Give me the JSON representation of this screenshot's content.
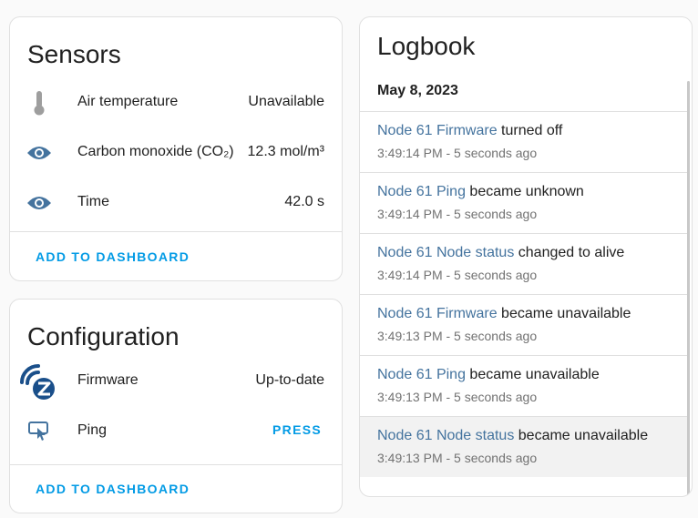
{
  "colors": {
    "background": "#fafafa",
    "accent": "#039be5",
    "entity_link": "#44739e",
    "icon": "#44739e"
  },
  "sensors": {
    "title": "Sensors",
    "rows": [
      {
        "icon": "thermometer-icon",
        "name": "Air temperature",
        "value": "Unavailable"
      },
      {
        "icon": "eye-icon",
        "name": "Carbon monoxide (CO₂)",
        "value": "12.3 mol/m³"
      },
      {
        "icon": "eye-icon",
        "name": "Time",
        "value": "42.0 s"
      }
    ],
    "action": "ADD TO DASHBOARD"
  },
  "configuration": {
    "title": "Configuration",
    "rows": [
      {
        "icon": "zwave-icon",
        "name": "Firmware",
        "value": "Up-to-date"
      },
      {
        "icon": "gesture-tap-button-icon",
        "name": "Ping",
        "action": "PRESS"
      }
    ],
    "action": "ADD TO DASHBOARD"
  },
  "logbook": {
    "title": "Logbook",
    "date": "May 8, 2023",
    "entries": [
      {
        "entity": "Node 61 Firmware",
        "message": " turned off",
        "time": "3:49:14 PM - 5 seconds ago"
      },
      {
        "entity": "Node 61 Ping",
        "message": " became unknown",
        "time": "3:49:14 PM - 5 seconds ago"
      },
      {
        "entity": "Node 61 Node status",
        "message": " changed to alive",
        "time": "3:49:14 PM - 5 seconds ago"
      },
      {
        "entity": "Node 61 Firmware",
        "message": " became unavailable",
        "time": "3:49:13 PM - 5 seconds ago"
      },
      {
        "entity": "Node 61 Ping",
        "message": " became unavailable",
        "time": "3:49:13 PM - 5 seconds ago"
      },
      {
        "entity": "Node 61 Node status",
        "message": " became unavailable",
        "time": "3:49:13 PM - 5 seconds ago"
      }
    ]
  }
}
